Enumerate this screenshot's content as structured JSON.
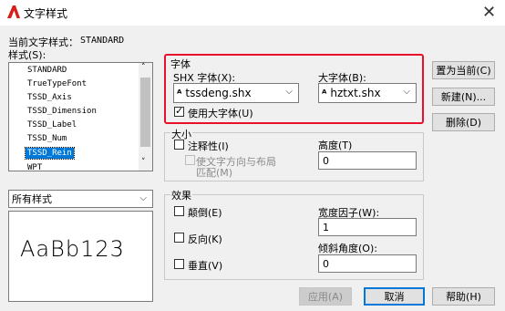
{
  "window": {
    "title": "文字样式",
    "app_icon": "autocad-logo-icon",
    "close_glyph": "✕"
  },
  "current_style": {
    "label": "当前文字样式：",
    "value": "STANDARD"
  },
  "styles": {
    "label": "样式(S):",
    "items": [
      "STANDARD",
      "TrueTypeFont",
      "TSSD_Axis",
      "TSSD_Dimension",
      "TSSD_Label",
      "TSSD_Num",
      "TSSD_Rein",
      "WPT"
    ],
    "selected_index": 6
  },
  "filter": {
    "value": "所有样式"
  },
  "preview": {
    "text": "AaBb123"
  },
  "font": {
    "group_label": "字体",
    "shx_label": "SHX 字体(X):",
    "shx_value": "tssdeng.shx",
    "big_label": "大字体(B):",
    "big_value": "hztxt.shx",
    "use_big_font_label": "使用大字体(U)",
    "use_big_font_checked": true
  },
  "size": {
    "group_label": "大小",
    "annotative_label": "注释性(I)",
    "match_orientation_label_1": "使文字方向与布局",
    "match_orientation_label_2": "匹配(M)",
    "height_label": "高度(T)",
    "height_value": "0"
  },
  "effects": {
    "group_label": "效果",
    "upside_down_label": "颠倒(E)",
    "backwards_label": "反向(K)",
    "vertical_label": "垂直(V)",
    "width_factor_label": "宽度因子(W):",
    "width_factor_value": "1",
    "oblique_label": "倾斜角度(O):",
    "oblique_value": "0"
  },
  "buttons": {
    "set_current": "置为当前(C)",
    "new": "新建(N)...",
    "delete": "删除(D)",
    "apply": "应用(A)",
    "cancel": "取消",
    "help": "帮助(H)"
  },
  "colors": {
    "highlight_border": "#e8102a",
    "selection": "#0078d7"
  }
}
